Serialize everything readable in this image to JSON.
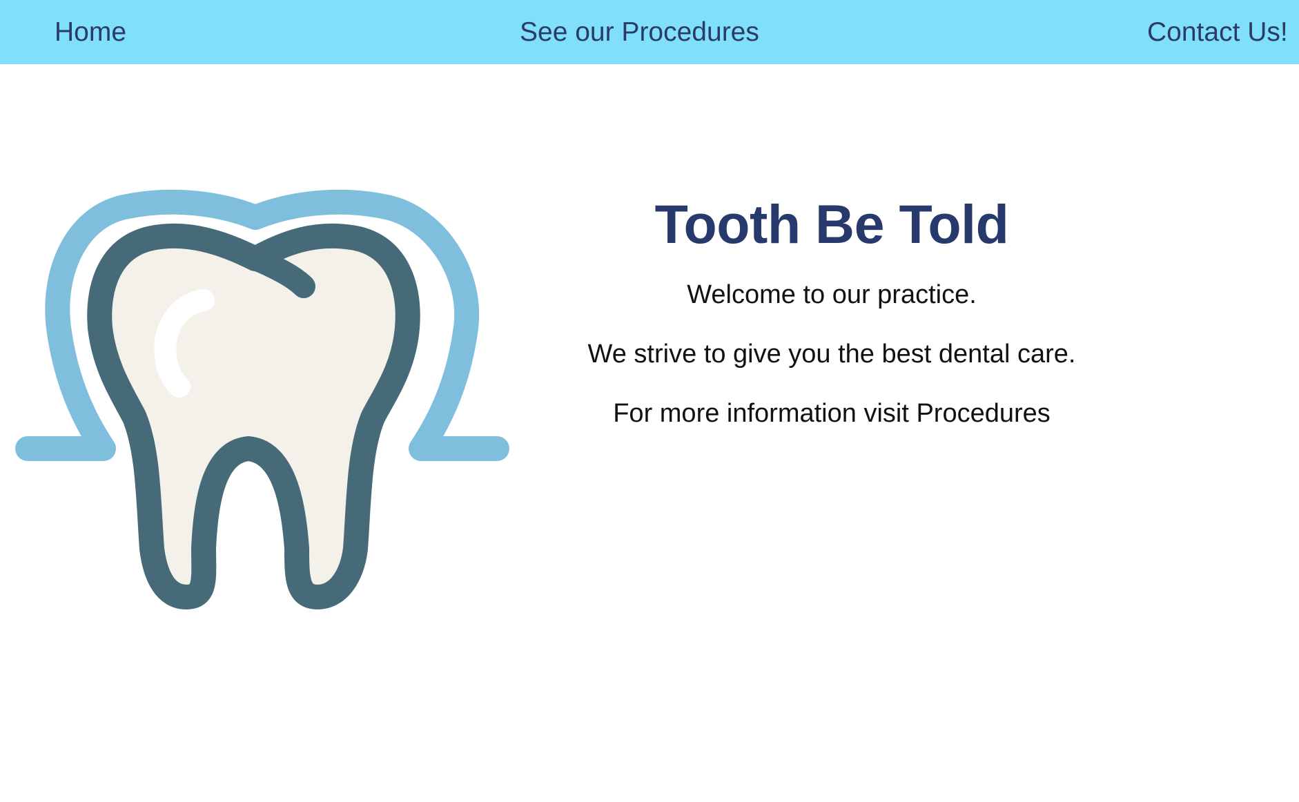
{
  "nav": {
    "home": "Home",
    "procedures": "See our Procedures",
    "contact": "Contact Us!"
  },
  "logo": {
    "icon": "tooth-icon",
    "colors": {
      "outer_outline": "#7fbfdd",
      "tooth_outline": "#466a77",
      "tooth_fill": "#f4f1ea",
      "highlight": "#ffffff"
    }
  },
  "hero": {
    "title": "Tooth Be Told",
    "line1": "Welcome to our practice.",
    "line2": "We strive to give you the best dental care.",
    "line3": "For more information visit Procedures"
  },
  "colors": {
    "navbar_bg": "#80dffa",
    "nav_text": "#2a3b64",
    "title_text": "#273a6b",
    "body_text": "#111111"
  }
}
